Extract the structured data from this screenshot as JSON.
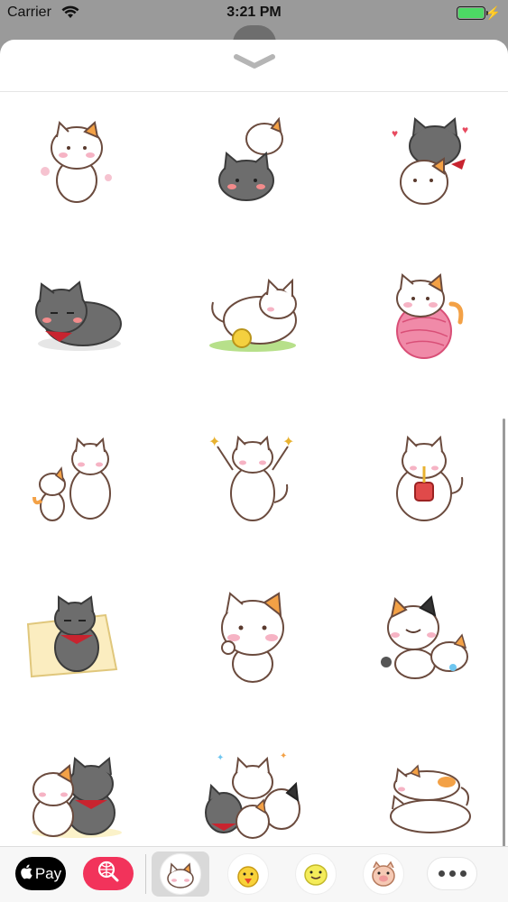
{
  "status_bar": {
    "carrier": "Carrier",
    "time": "3:21 PM",
    "battery_percent": 100
  },
  "sheet": {
    "collapse_icon": "chevron-down-icon"
  },
  "stickers": [
    [
      "cat-waving",
      "cat-hug-gray",
      "cat-hearts"
    ],
    [
      "gray-cat-lying",
      "cat-with-ball",
      "cat-on-yarn"
    ],
    [
      "cats-greeting",
      "cat-cheering",
      "cat-drinking"
    ],
    [
      "gray-cat-sofa",
      "cat-blushing",
      "calico-cat-with-kitten"
    ],
    [
      "cat-couple",
      "cat-group",
      "cats-stacked"
    ]
  ],
  "tray": {
    "apple_pay_label": "Pay",
    "search_icon": "globe-search-icon",
    "apps": [
      "cat-sticker-app",
      "chick-sticker-app",
      "duck-sticker-app",
      "pig-sticker-app"
    ],
    "more_icon": "more-icon"
  },
  "colors": {
    "accent_search": "#f2335b",
    "battery": "#4cd964"
  }
}
